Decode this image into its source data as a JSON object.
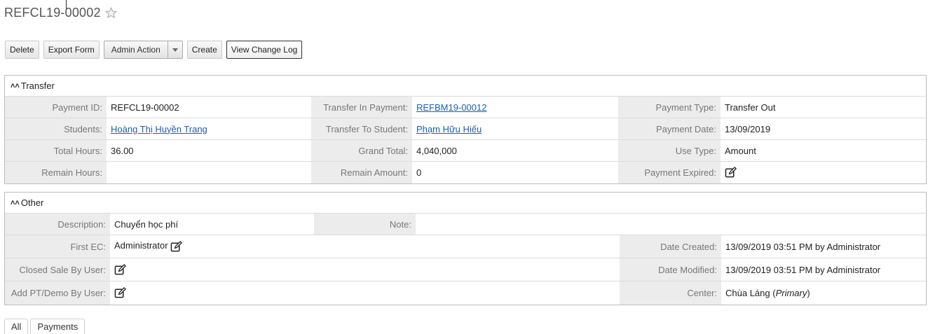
{
  "header": {
    "title": "REFCL19-00002",
    "star_icon": "star-outline-icon"
  },
  "toolbar": {
    "delete": "Delete",
    "export_form": "Export Form",
    "admin_action": "Admin Action",
    "create": "Create",
    "view_change_log": "View Change Log"
  },
  "transfer": {
    "heading": "Transfer",
    "labels": {
      "payment_id": "Payment ID:",
      "transfer_in_payment": "Transfer In Payment:",
      "payment_type": "Payment Type:",
      "students": "Students:",
      "transfer_to_student": "Transfer To Student:",
      "payment_date": "Payment Date:",
      "total_hours": "Total Hours:",
      "grand_total": "Grand Total:",
      "use_type": "Use Type:",
      "remain_hours": "Remain Hours:",
      "remain_amount": "Remain Amount:",
      "payment_expired": "Payment Expired:"
    },
    "values": {
      "payment_id": "REFCL19-00002",
      "transfer_in_payment": "REFBM19-00012",
      "payment_type": "Transfer Out",
      "students": "Hoàng Thị Huyền Trang",
      "transfer_to_student": "Phạm Hữu Hiếu",
      "payment_date": "13/09/2019",
      "total_hours": "36.00",
      "grand_total": "4,040,000",
      "use_type": "Amount",
      "remain_hours": "",
      "remain_amount": "0"
    }
  },
  "other": {
    "heading": "Other",
    "labels": {
      "description": "Description:",
      "note": "Note:",
      "first_ec": "First EC:",
      "date_created": "Date Created:",
      "closed_sale_by_user": "Closed Sale By User:",
      "date_modified": "Date Modified:",
      "add_pt_demo_by_user": "Add PT/Demo By User:",
      "center": "Center:"
    },
    "values": {
      "description": "Chuyển học phí",
      "note": "",
      "first_ec": "Administrator",
      "date_created": "13/09/2019 03:51 PM by Administrator",
      "date_modified": "13/09/2019 03:51 PM by Administrator",
      "center_name": "Chùa Láng (",
      "center_tag": "Primary",
      "center_close": ")"
    }
  },
  "tabs": [
    "All",
    "Payments"
  ]
}
